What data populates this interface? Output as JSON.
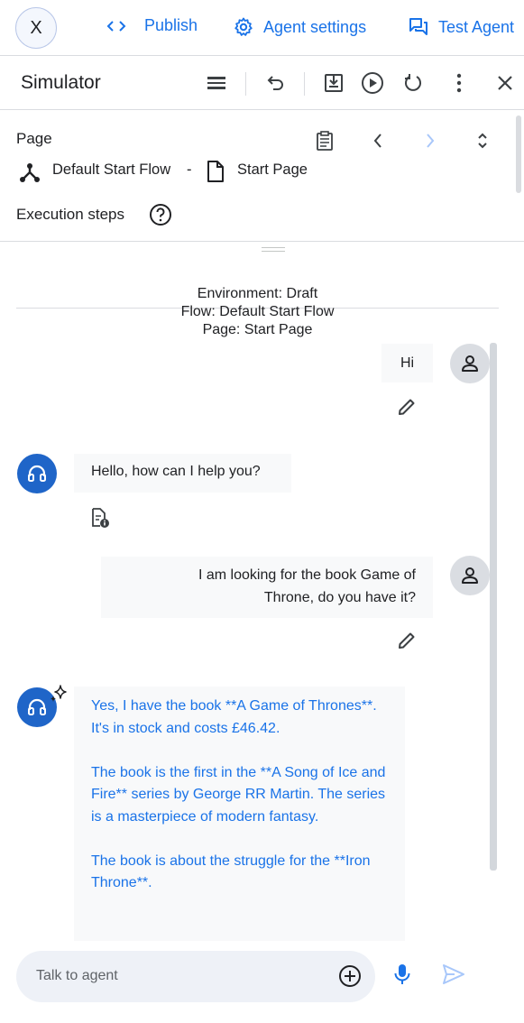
{
  "topbar": {
    "x_label": "X",
    "publish_label": "Publish",
    "agent_settings_label": "Agent settings",
    "test_agent_label": "Test Agent"
  },
  "simulator": {
    "title": "Simulator"
  },
  "page_section": {
    "page_label": "Page",
    "flow_name": "Default Start Flow",
    "separator": "-",
    "page_name": "Start Page",
    "execution_steps_label": "Execution steps"
  },
  "environment": {
    "line1": "Environment: Draft",
    "line2": "Flow: Default Start Flow",
    "line3": "Page: Start Page"
  },
  "messages": [
    {
      "role": "user",
      "text": "Hi"
    },
    {
      "role": "agent",
      "text": "Hello, how can I help you?"
    },
    {
      "role": "user",
      "line1": "I am looking for the book Game of",
      "line2": "Throne, do you have it?"
    },
    {
      "role": "agent-generative",
      "paragraphs": [
        "Yes, I have the book **A Game of Thrones**. It's in stock and costs £46.42.",
        "The book is the first in the **A Song of Ice and Fire** series by George RR Martin. The series is a masterpiece of modern fantasy.",
        "The book is about the struggle for the **Iron Throne**."
      ]
    }
  ],
  "input": {
    "placeholder": "Talk to agent"
  },
  "colors": {
    "accent": "#1a73e8",
    "agent_avatar": "#1f65c8",
    "user_avatar": "#dadde2",
    "bubble": "#f8f9fa",
    "input_bg": "#eef1f7"
  }
}
